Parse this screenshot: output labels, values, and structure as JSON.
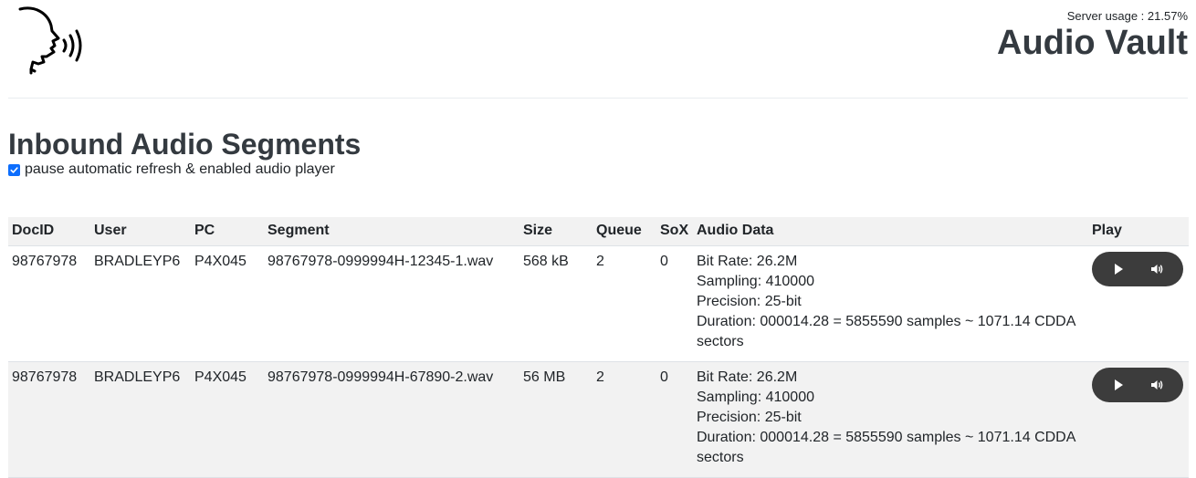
{
  "header": {
    "server_usage": "Server usage : 21.57%",
    "app_title": "Audio Vault",
    "logo_icon": "speaking-head-icon"
  },
  "page": {
    "title": "Inbound Audio Segments",
    "pause_label": "pause automatic refresh & enabled audio player",
    "pause_checked": true
  },
  "table": {
    "columns": [
      "DocID",
      "User",
      "PC",
      "Segment",
      "Size",
      "Queue",
      "SoX",
      "Audio Data",
      "Play"
    ],
    "rows": [
      {
        "docid": "98767978",
        "user": "BRADLEYP6",
        "pc": "P4X045",
        "segment": "98767978-0999994H-12345-1.wav",
        "size": "568 kB",
        "queue": "2",
        "sox": "0",
        "bit_rate": "Bit Rate: 26.2M",
        "sampling": "Sampling: 410000",
        "precision": "Precision: 25-bit",
        "duration": "Duration: 000014.28 = 5855590 samples ~ 1071.14 CDDA sectors"
      },
      {
        "docid": "98767978",
        "user": "BRADLEYP6",
        "pc": "P4X045",
        "segment": "98767978-0999994H-67890-2.wav",
        "size": "56 MB",
        "queue": "2",
        "sox": "0",
        "bit_rate": "Bit Rate: 26.2M",
        "sampling": "Sampling: 410000",
        "precision": "Precision: 25-bit",
        "duration": "Duration: 000014.28 = 5855590 samples ~ 1071.14 CDDA sectors"
      }
    ]
  },
  "colors": {
    "title": "#343a40",
    "header_bg": "#f2f2f2",
    "checkbox": "#0d6efd",
    "player_bg": "#3c3c3c"
  }
}
